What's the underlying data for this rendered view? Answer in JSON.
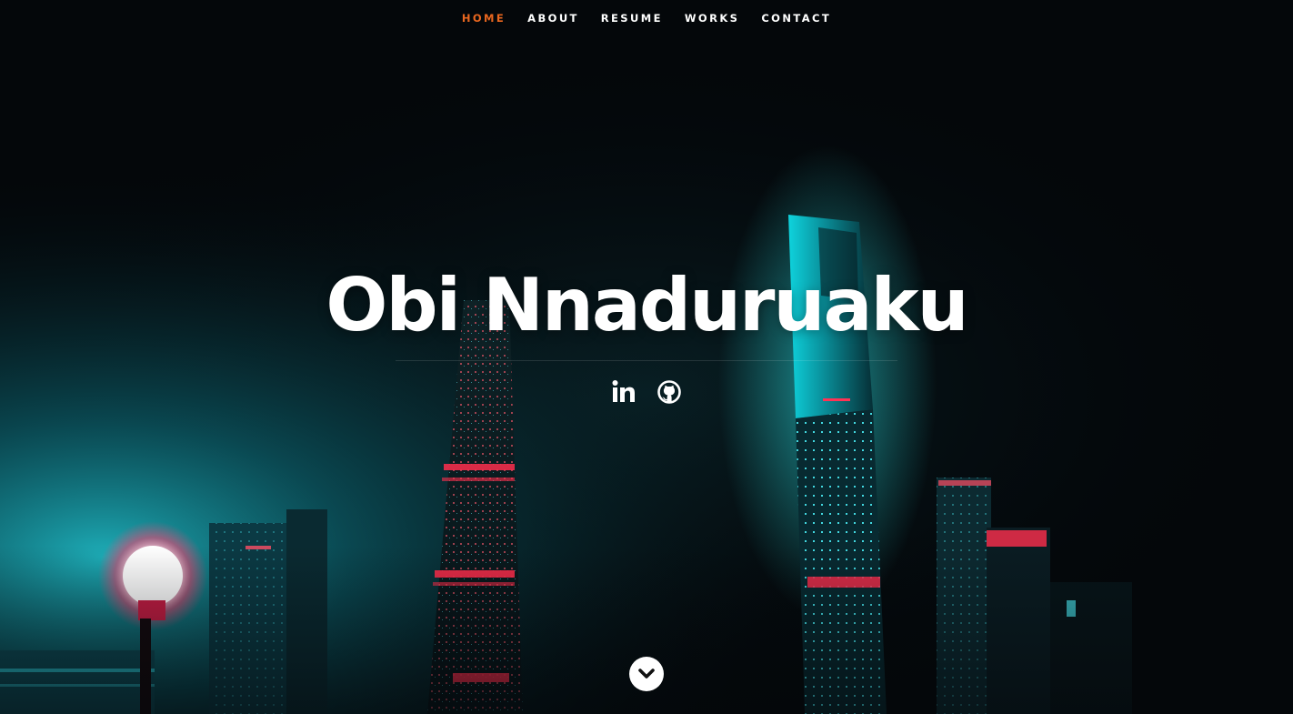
{
  "nav": {
    "items": [
      {
        "label": "HOME",
        "active": true
      },
      {
        "label": "ABOUT",
        "active": false
      },
      {
        "label": "RESUME",
        "active": false
      },
      {
        "label": "WORKS",
        "active": false
      },
      {
        "label": "CONTACT",
        "active": false
      }
    ],
    "active_color": "#e8661f"
  },
  "hero": {
    "name": "Obi Nnaduruaku",
    "background": "night-city-skyline-neon",
    "social": [
      {
        "icon": "linkedin-icon"
      },
      {
        "icon": "github-icon"
      }
    ],
    "scroll_icon": "chevron-down-icon"
  }
}
